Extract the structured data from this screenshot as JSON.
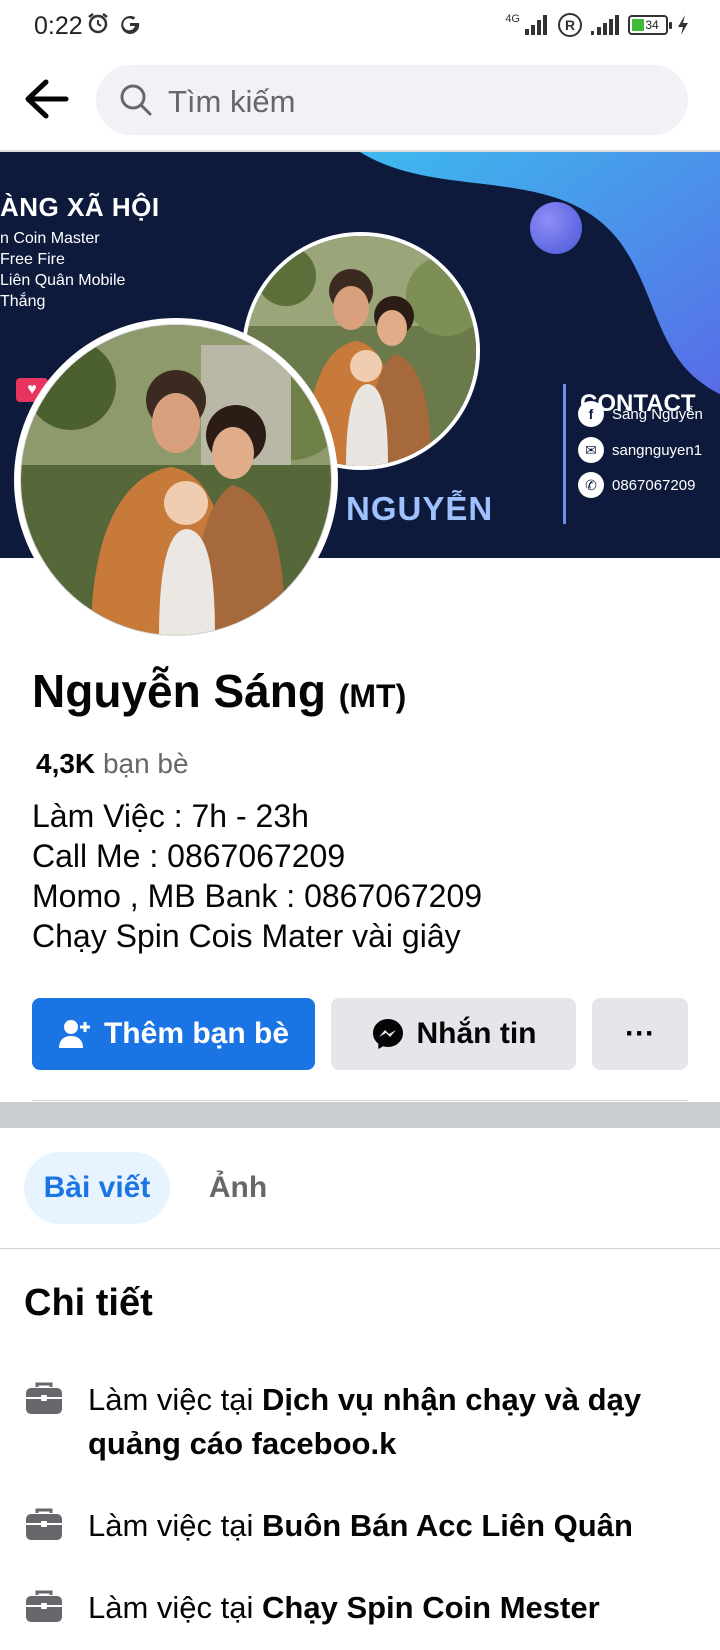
{
  "status_bar": {
    "time": "0:22",
    "network_label": "4G",
    "roaming_label": "R",
    "battery_level": "34"
  },
  "search": {
    "placeholder": "Tìm kiếm"
  },
  "cover": {
    "title": "ÀNG XÃ HỘI",
    "list": [
      "n Coin Master",
      "Free Fire",
      "Liên Quân Mobile",
      "Thắng"
    ],
    "name_text": "NGUYỄN",
    "contact_title": "CONTACT",
    "contacts": [
      "Sáng Nguyễn",
      "sangnguyen1",
      "0867067209"
    ]
  },
  "profile": {
    "name": "Nguyễn Sáng",
    "name_suffix": "(MT)",
    "friends_count": "4,3K",
    "friends_label": "bạn bè",
    "bio_lines": [
      "Làm Việc : 7h - 23h",
      "Call Me : 0867067209",
      "Momo , MB Bank : 0867067209",
      "Chạy Spin Cois Mater vài giây"
    ]
  },
  "actions": {
    "add_friend": "Thêm bạn bè",
    "message": "Nhắn tin",
    "more": "···"
  },
  "tabs": {
    "posts": "Bài viết",
    "photos": "Ảnh"
  },
  "details": {
    "title": "Chi tiết",
    "items": [
      {
        "prefix": "Làm việc tại",
        "place": "Dịch vụ nhận chạy và dạy quảng cáo faceboo.k"
      },
      {
        "prefix": "Làm việc tại",
        "place": "Buôn Bán Acc Liên Quân"
      },
      {
        "prefix": "Làm việc tại",
        "place": "Chạy Spin Coin Mester"
      }
    ]
  },
  "colors": {
    "primary": "#1b74e4",
    "secondary_bg": "#e4e6eb",
    "search_bg": "#f0f2f5",
    "cover_bg": "#0e1a3b"
  }
}
